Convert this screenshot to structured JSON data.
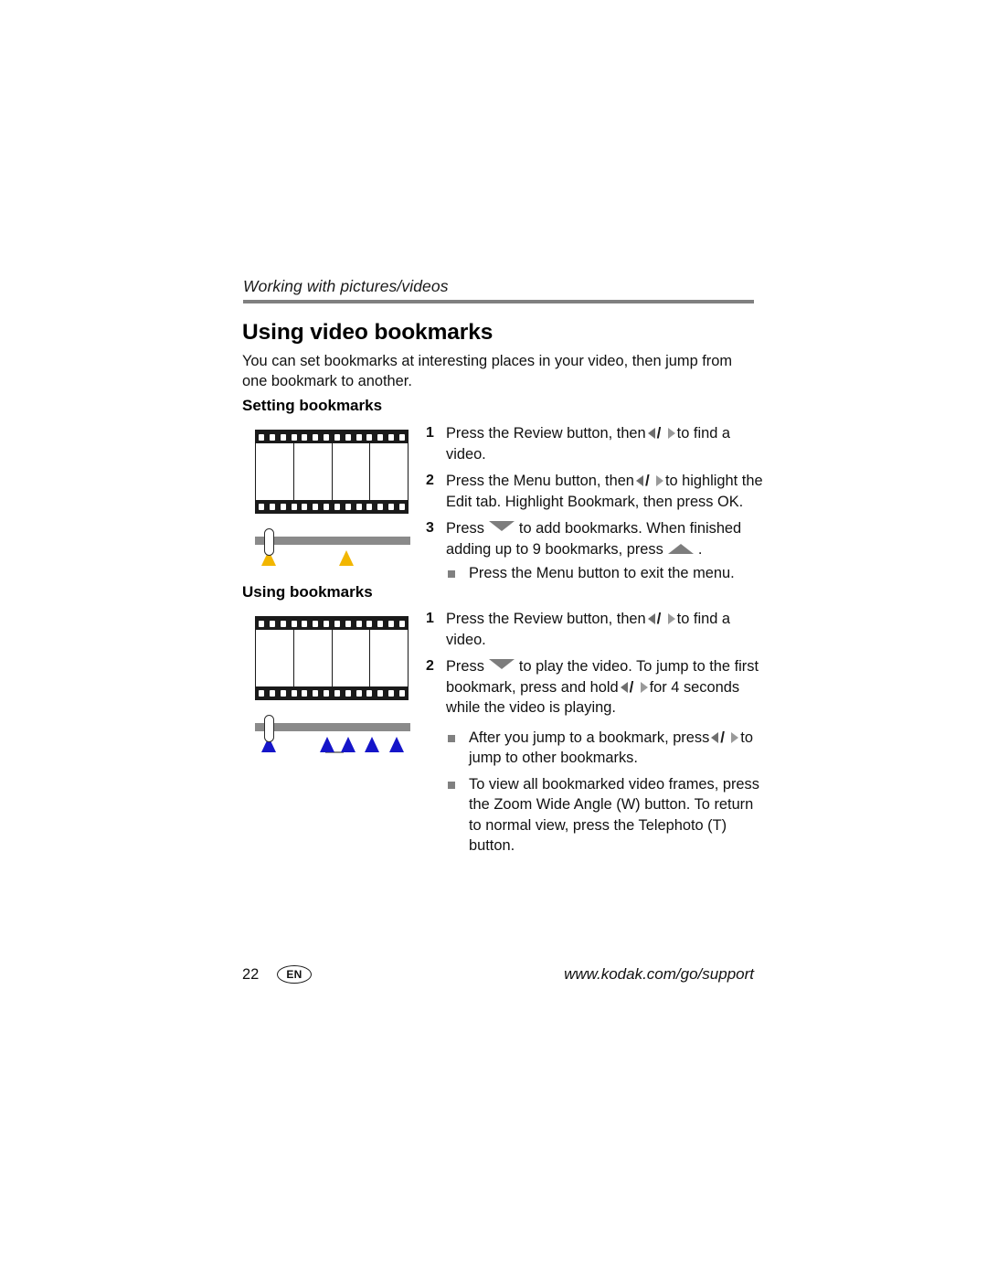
{
  "page": {
    "running_head": "Working with pictures/videos",
    "title": "Using video bookmarks",
    "intro": "You can set bookmarks at interesting places in your video, then jump from one bookmark to another."
  },
  "sections": {
    "setting": {
      "heading": "Setting bookmarks",
      "steps": [
        {
          "num": "1",
          "before": "Press the Review button, then",
          "glyph": "left-right-arrows",
          "after": "to find a video."
        },
        {
          "num": "2",
          "before": "Press the Menu button, then",
          "glyph": "left-right-arrows",
          "after": "to highlight the Edit tab. Highlight Bookmark, then press OK."
        },
        {
          "num": "3",
          "before": "Press",
          "glyph": "down-arrow",
          "mid": "to add bookmarks. When finished adding up to 9 bookmarks, press",
          "glyph2": "up-arrow",
          "after": "."
        }
      ],
      "bullets": [
        "Press the Menu button to exit the menu."
      ]
    },
    "using": {
      "heading": "Using bookmarks",
      "steps": [
        {
          "num": "1",
          "before": "Press the Review button, then",
          "glyph": "left-right-arrows",
          "after": "to find a video."
        },
        {
          "num": "2",
          "before": "Press",
          "glyph": "down-arrow",
          "mid": "to play the video. To jump to the first bookmark, press and hold",
          "glyph2": "left-right-arrows",
          "after": "for 4 seconds while the video is playing."
        }
      ],
      "bullets": [
        {
          "before": "After you jump to a bookmark, press",
          "glyph": "left-right-arrows",
          "after": "to jump to other bookmarks."
        },
        {
          "text": "To view all bookmarked video frames, press the Zoom Wide Angle (W) button. To return to normal view, press the Telephoto (T) button."
        }
      ]
    }
  },
  "illustrations": {
    "setting": {
      "name": "filmstrip-with-yellow-bookmarks",
      "frames": 4,
      "perforations": 14,
      "marker_color": "#f2b600",
      "markers": 2
    },
    "using": {
      "name": "filmstrip-with-blue-bookmarks",
      "frames": 4,
      "perforations": 14,
      "marker_color": "#1515c9",
      "markers": 5
    }
  },
  "footer": {
    "page_number": "22",
    "language": "EN",
    "url": "www.kodak.com/go/support"
  }
}
